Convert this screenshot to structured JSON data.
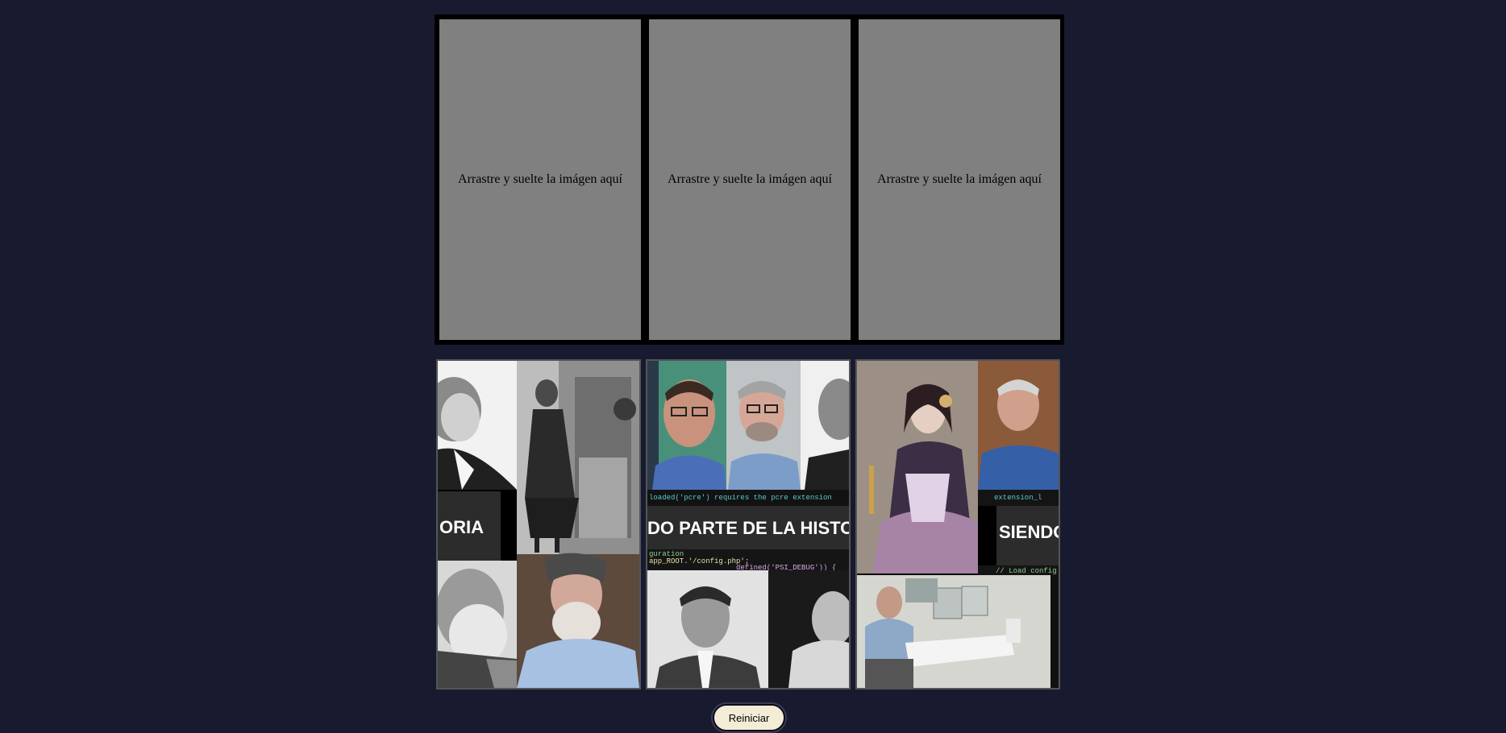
{
  "drop_zones": [
    {
      "label": "Arrastre y suelte la imágen aquí"
    },
    {
      "label": "Arrastre y suelte la imágen aquí"
    },
    {
      "label": "Arrastre y suelte la imágen aquí"
    }
  ],
  "pieces": [
    {
      "name": "puzzle-piece-1",
      "banner_text": "ORIA"
    },
    {
      "name": "puzzle-piece-2",
      "banner_text": "DO PARTE DE LA HISTO"
    },
    {
      "name": "puzzle-piece-3",
      "banner_text": "SIENDO"
    }
  ],
  "code_snippets": {
    "piece2_top": "loaded('pcre') requires the pcre extension",
    "piece2_bottom_1": "guration",
    "piece2_bottom_2": "app_ROOT.'/config.php';",
    "piece2_bottom_3": "defined('PSI_DEBUG')) {",
    "piece3_top": "extension_l",
    "piece3_bottom": "// Load config"
  },
  "reset_button": {
    "label": "Reiniciar"
  },
  "colors": {
    "page_background": "#181b30",
    "drop_zone": "#808080",
    "button_background": "#f3ecd6"
  }
}
